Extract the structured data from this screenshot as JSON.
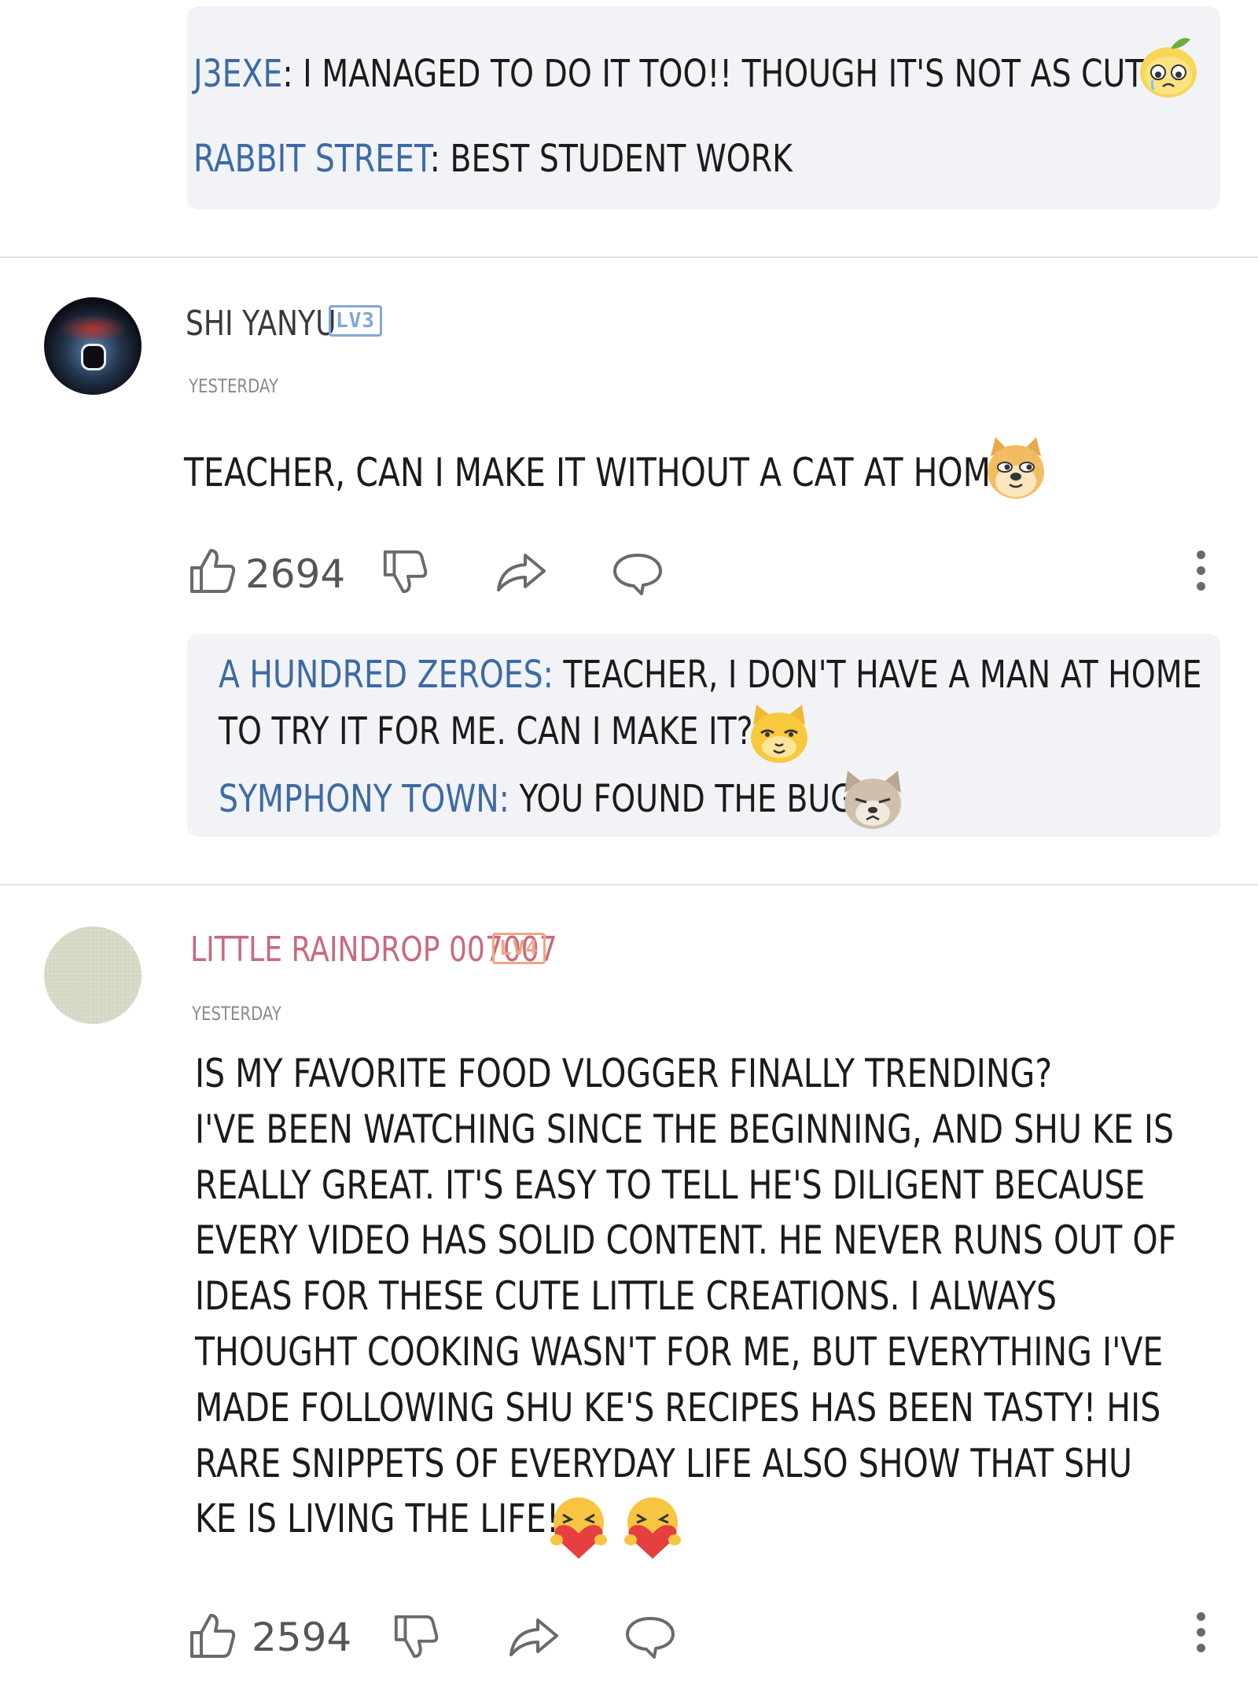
{
  "top_replies": [
    {
      "author": "J3EXE",
      "text": ": I MANAGED TO DO IT TOO!! THOUGH IT'S NOT AS CUTE",
      "emoji": "crying-lemon-emoji"
    },
    {
      "author": "RABBIT STREET",
      "text": ": BEST STUDENT WORK"
    }
  ],
  "comments": [
    {
      "username": "SHI YANYU",
      "level": "LV3",
      "timestamp": "YESTERDAY",
      "text": "TEACHER, CAN I MAKE IT WITHOUT A CAT AT HOME?",
      "text_emoji": "doge-emoji",
      "likes": "2694",
      "replies": [
        {
          "author": "A HUNDRED ZEROES:",
          "text": " TEACHER, I DON'T HAVE A MAN AT HOME",
          "continuation": "TO TRY IT FOR ME. CAN I MAKE IT?",
          "emoji": "smug-cat-emoji"
        },
        {
          "author": "SYMPHONY TOWN:",
          "text": " YOU FOUND THE BUG",
          "emoji": "wolf-emoji"
        }
      ]
    },
    {
      "username": "LITTLE RAINDROP 007007",
      "level": "LV4",
      "timestamp": "YESTERDAY",
      "text_lines": [
        "IS MY FAVORITE FOOD VLOGGER FINALLY TRENDING?",
        "I'VE BEEN WATCHING SINCE THE BEGINNING, AND SHU KE IS",
        "REALLY GREAT. IT'S EASY TO TELL HE'S DILIGENT BECAUSE",
        "EVERY VIDEO HAS SOLID CONTENT. HE NEVER RUNS OUT OF",
        "IDEAS FOR THESE CUTE LITTLE CREATIONS. I ALWAYS",
        "THOUGHT COOKING WASN'T FOR ME, BUT EVERYTHING I'VE",
        "MADE FOLLOWING SHU KE'S RECIPES HAS BEEN TASTY! HIS",
        "RARE SNIPPETS OF EVERYDAY LIFE ALSO SHOW THAT SHU",
        "KE IS LIVING THE LIFE!"
      ],
      "text_emoji": [
        "heart-hug-emoji",
        "heart-hug-emoji"
      ],
      "likes": "2594"
    }
  ],
  "icons": [
    "thumbs-up-icon",
    "thumbs-down-icon",
    "share-icon",
    "reply-icon",
    "more-icon"
  ],
  "colors": {
    "author_link": "#3d6aa3",
    "username_pink": "#c86a7e",
    "level_blue": "#7fa8d6",
    "level_orange": "#f0a585",
    "reply_bg": "#f1f3f6",
    "icon_gray": "#6a6a6a"
  }
}
